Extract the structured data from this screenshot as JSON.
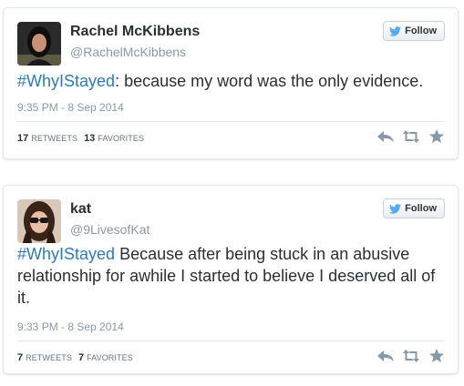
{
  "colors": {
    "hashtag": "#2b7bb9",
    "muted": "#8899a6",
    "border": "#e1e8ed",
    "twitter_blue": "#55acee",
    "icon_gray": "#8899a6"
  },
  "tweets": [
    {
      "name": "Rachel McKibbens",
      "handle": "@RachelMcKibbens",
      "follow_label": "Follow",
      "hashtag": "#WhyIStayed",
      "body": ": because my word was the only evidence.",
      "timestamp": "9:35 PM - 8 Sep 2014",
      "retweets_count": "17",
      "retweets_label": "RETWEETS",
      "favorites_count": "13",
      "favorites_label": "FAVORITES",
      "icons": [
        "twitter-bird-icon",
        "reply-icon",
        "retweet-icon",
        "favorite-star-icon"
      ]
    },
    {
      "name": "kat",
      "handle": "@9LivesofKat",
      "follow_label": "Follow",
      "hashtag": "#WhyIStayed",
      "body": " Because after being stuck in an abusive relationship for awhile I started to believe I deserved all of it.",
      "timestamp": "9:33 PM - 8 Sep 2014",
      "retweets_count": "7",
      "retweets_label": "RETWEETS",
      "favorites_count": "7",
      "favorites_label": "FAVORITES",
      "icons": [
        "twitter-bird-icon",
        "reply-icon",
        "retweet-icon",
        "favorite-star-icon"
      ]
    }
  ]
}
